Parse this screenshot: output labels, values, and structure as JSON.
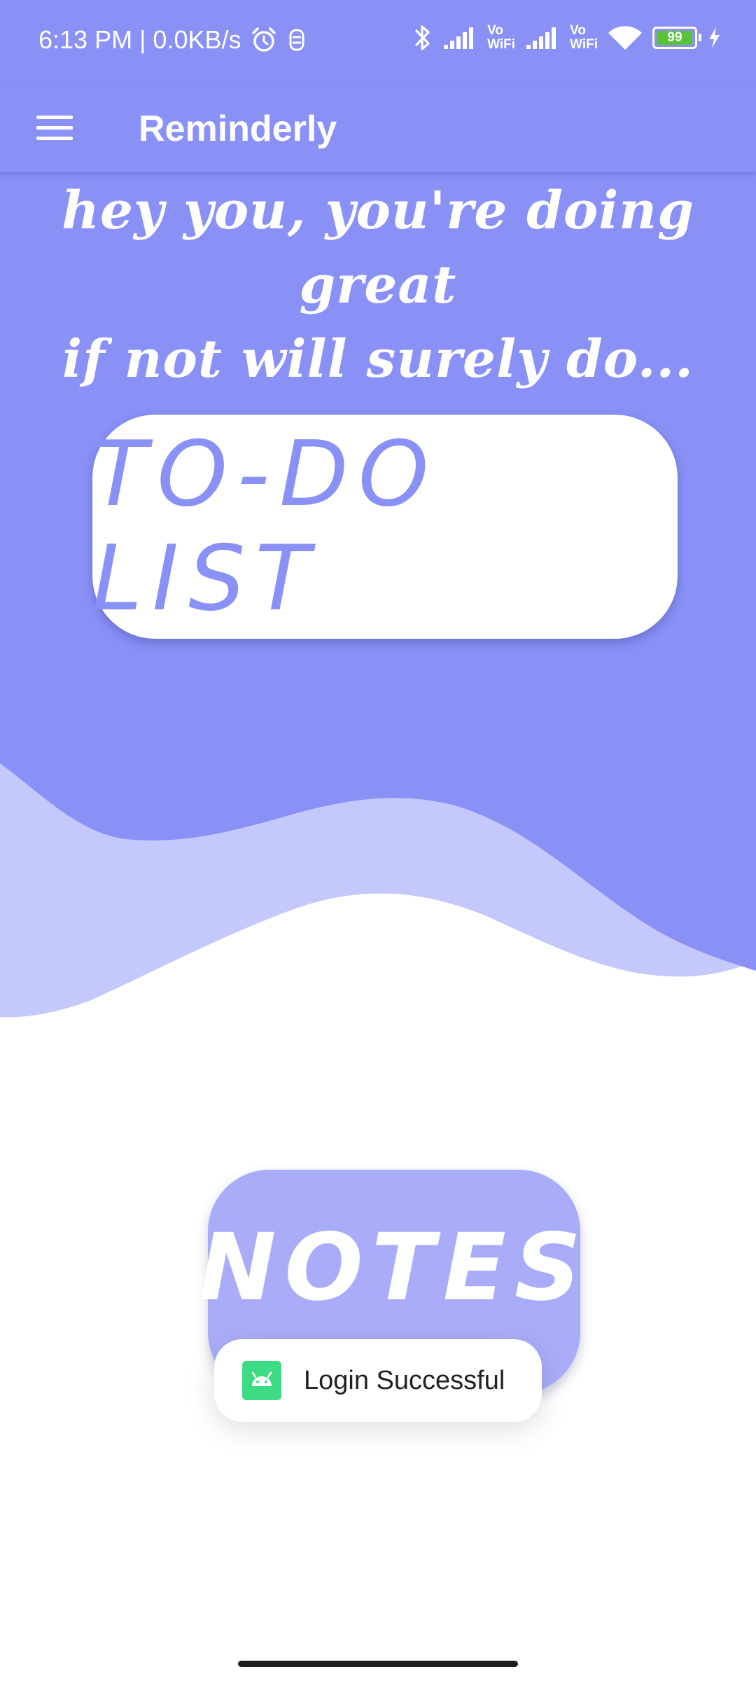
{
  "status_bar": {
    "time_speed": "6:13 PM | 0.0KB/s",
    "volte1": [
      "Vo",
      "WiFi"
    ],
    "volte2": [
      "Vo",
      "WiFi"
    ],
    "battery": "99",
    "battery_level": 0.99,
    "icons": [
      "alarm-icon",
      "data-saver-icon",
      "bluetooth-icon",
      "signal-icon",
      "wifi-icon",
      "battery-icon",
      "charging-icon"
    ]
  },
  "app_bar": {
    "title": "Reminderly",
    "menu_icon": "hamburger-menu-icon"
  },
  "hero": {
    "line1": "hey you, you're doing great",
    "line2": "if not will surely do..."
  },
  "todo_button": {
    "label": "TO-DO LIST"
  },
  "notes_button": {
    "label": "NOTES"
  },
  "toast": {
    "message": "Login Successful",
    "icon": "android-app-icon"
  },
  "colors": {
    "primary": "#8991f7",
    "wave_light": "#c5c8fc",
    "notes_bg": "#a9adf9",
    "toast_icon_bg": "#3ddc84",
    "battery_fill": "#59c23a",
    "background": "#ffffff"
  }
}
